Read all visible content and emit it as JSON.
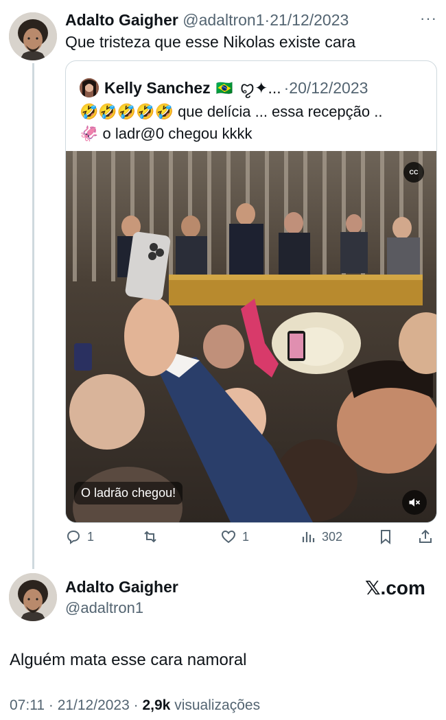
{
  "reply_tweet": {
    "author_name": "Adalto Gaigher",
    "handle": "@adaltron1",
    "separator": "·",
    "date": "21/12/2023",
    "more_glyph": "···",
    "text": "Que tristeza que esse Nikolas existe cara"
  },
  "quoted_tweet": {
    "author_name": "Kelly Sanchez",
    "flag": "🇧🇷",
    "name_suffix": "ꨄ✦...",
    "separator": "·",
    "date": "20/12/2023",
    "text_line1": "🤣🤣🤣🤣🤣 que delícia ... essa recepção ..",
    "text_line2": "🦑 o ladr@0 chegou kkkk",
    "video": {
      "cc_label": "CC",
      "caption": "O ladrão chegou!"
    }
  },
  "actions": {
    "replies": "1",
    "retweets": "",
    "likes": "1",
    "views": "302"
  },
  "main_tweet": {
    "author_name": "Adalto Gaigher",
    "handle": "@adaltron1",
    "watermark": "𝕏.com",
    "text": "Alguém mata esse cara namoral",
    "time": "07:11",
    "separator": "·",
    "date": "21/12/2023",
    "separator2": "·",
    "views_count": "2,9k",
    "views_label": "visualizações"
  },
  "colors": {
    "text_primary": "#0f1419",
    "text_muted": "#536471",
    "border": "#cfd9de"
  },
  "icons": [
    "reply-icon",
    "retweet-icon",
    "like-icon",
    "views-icon",
    "bookmark-icon",
    "share-icon",
    "mute-icon",
    "more-icon"
  ]
}
